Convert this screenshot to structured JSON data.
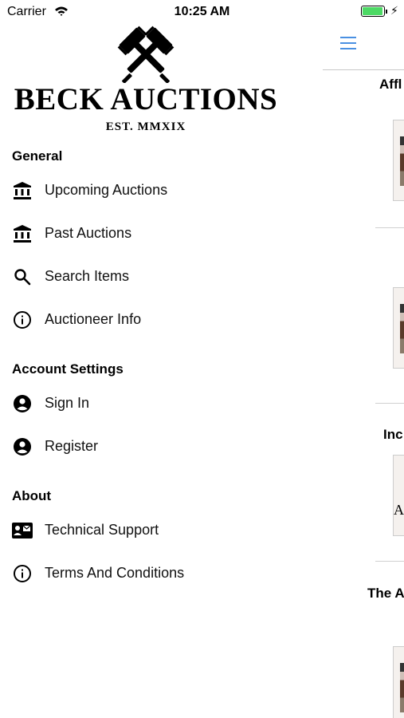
{
  "status_bar": {
    "carrier": "Carrier",
    "time": "10:25 AM",
    "battery_level": 1.0,
    "battery_color": "#4cd964"
  },
  "brand": {
    "name": "BECK AUCTIONS",
    "subtitle": "EST. MMXIX",
    "logo_icon": "crossed-gavels-icon"
  },
  "menu": {
    "general": {
      "header": "General",
      "items": [
        {
          "label": "Upcoming Auctions",
          "icon": "bank-icon"
        },
        {
          "label": "Past Auctions",
          "icon": "bank-icon"
        },
        {
          "label": "Search Items",
          "icon": "search-icon"
        },
        {
          "label": "Auctioneer Info",
          "icon": "info-icon"
        }
      ]
    },
    "account": {
      "header": "Account Settings",
      "items": [
        {
          "label": "Sign In",
          "icon": "account-circle-icon"
        },
        {
          "label": "Register",
          "icon": "account-circle-icon"
        }
      ]
    },
    "about": {
      "header": "About",
      "items": [
        {
          "label": "Technical Support",
          "icon": "contact-card-icon"
        },
        {
          "label": "Terms And Conditions",
          "icon": "info-icon"
        }
      ]
    }
  },
  "background": {
    "menu_icon": "hamburger-icon",
    "accent_color": "#4a90e2",
    "items": [
      {
        "title": "Affl"
      },
      {
        "title": ""
      },
      {
        "title": "Inc"
      },
      {
        "title": "The A"
      }
    ],
    "thumb_letter": "A"
  }
}
